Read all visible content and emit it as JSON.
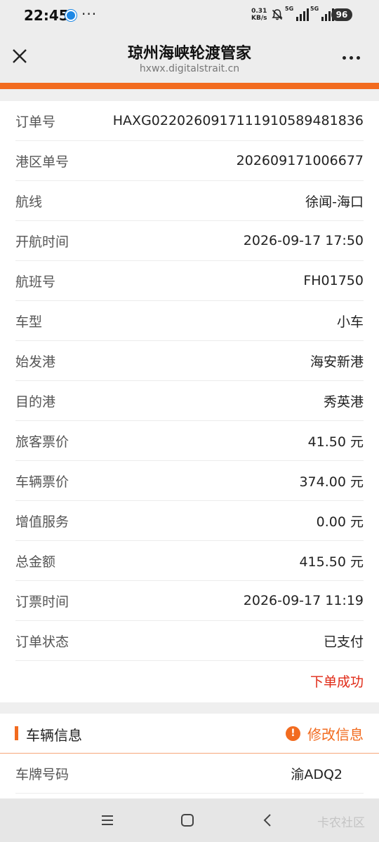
{
  "status_bar": {
    "time": "22:45",
    "speed_value": "0.31",
    "speed_unit": "KB/s",
    "network_1": "5G",
    "network_2": "5G",
    "battery": "96"
  },
  "header": {
    "title": "琼州海峡轮渡管家",
    "url": "hxwx.digitalstrait.cn"
  },
  "order": {
    "rows": [
      {
        "label": "订单号",
        "value": "HAXG02202609171119105894818​36"
      },
      {
        "label": "港区单号",
        "value": "202609171006677"
      },
      {
        "label": "航线",
        "value": "徐闻-海口"
      },
      {
        "label": "开航时间",
        "value": "2026-09-17 17:50"
      },
      {
        "label": "航班号",
        "value": "FH01750"
      },
      {
        "label": "车型",
        "value": "小车"
      },
      {
        "label": "始发港",
        "value": "海安新港"
      },
      {
        "label": "目的港",
        "value": "秀英港"
      },
      {
        "label": "旅客票价",
        "value": "41.50 元"
      },
      {
        "label": "车辆票价",
        "value": "374.00 元"
      },
      {
        "label": "增值服务",
        "value": "0.00 元"
      },
      {
        "label": "总金额",
        "value": "415.50 元"
      },
      {
        "label": "订票时间",
        "value": "2026-09-17 11:19"
      },
      {
        "label": "订单状态",
        "value": "已支付"
      }
    ],
    "result": "下单成功"
  },
  "vehicle": {
    "section_title": "车辆信息",
    "edit_label": "修改信息",
    "plate_label": "车牌号码",
    "plate_value": "渝ADQ2"
  },
  "watermark": "卡农社区",
  "colors": {
    "accent": "#f26b1f",
    "success_text": "#e02a16"
  },
  "icons": [
    "close-icon",
    "more-icon",
    "info-icon",
    "menu-icon",
    "home-icon",
    "back-icon"
  ]
}
